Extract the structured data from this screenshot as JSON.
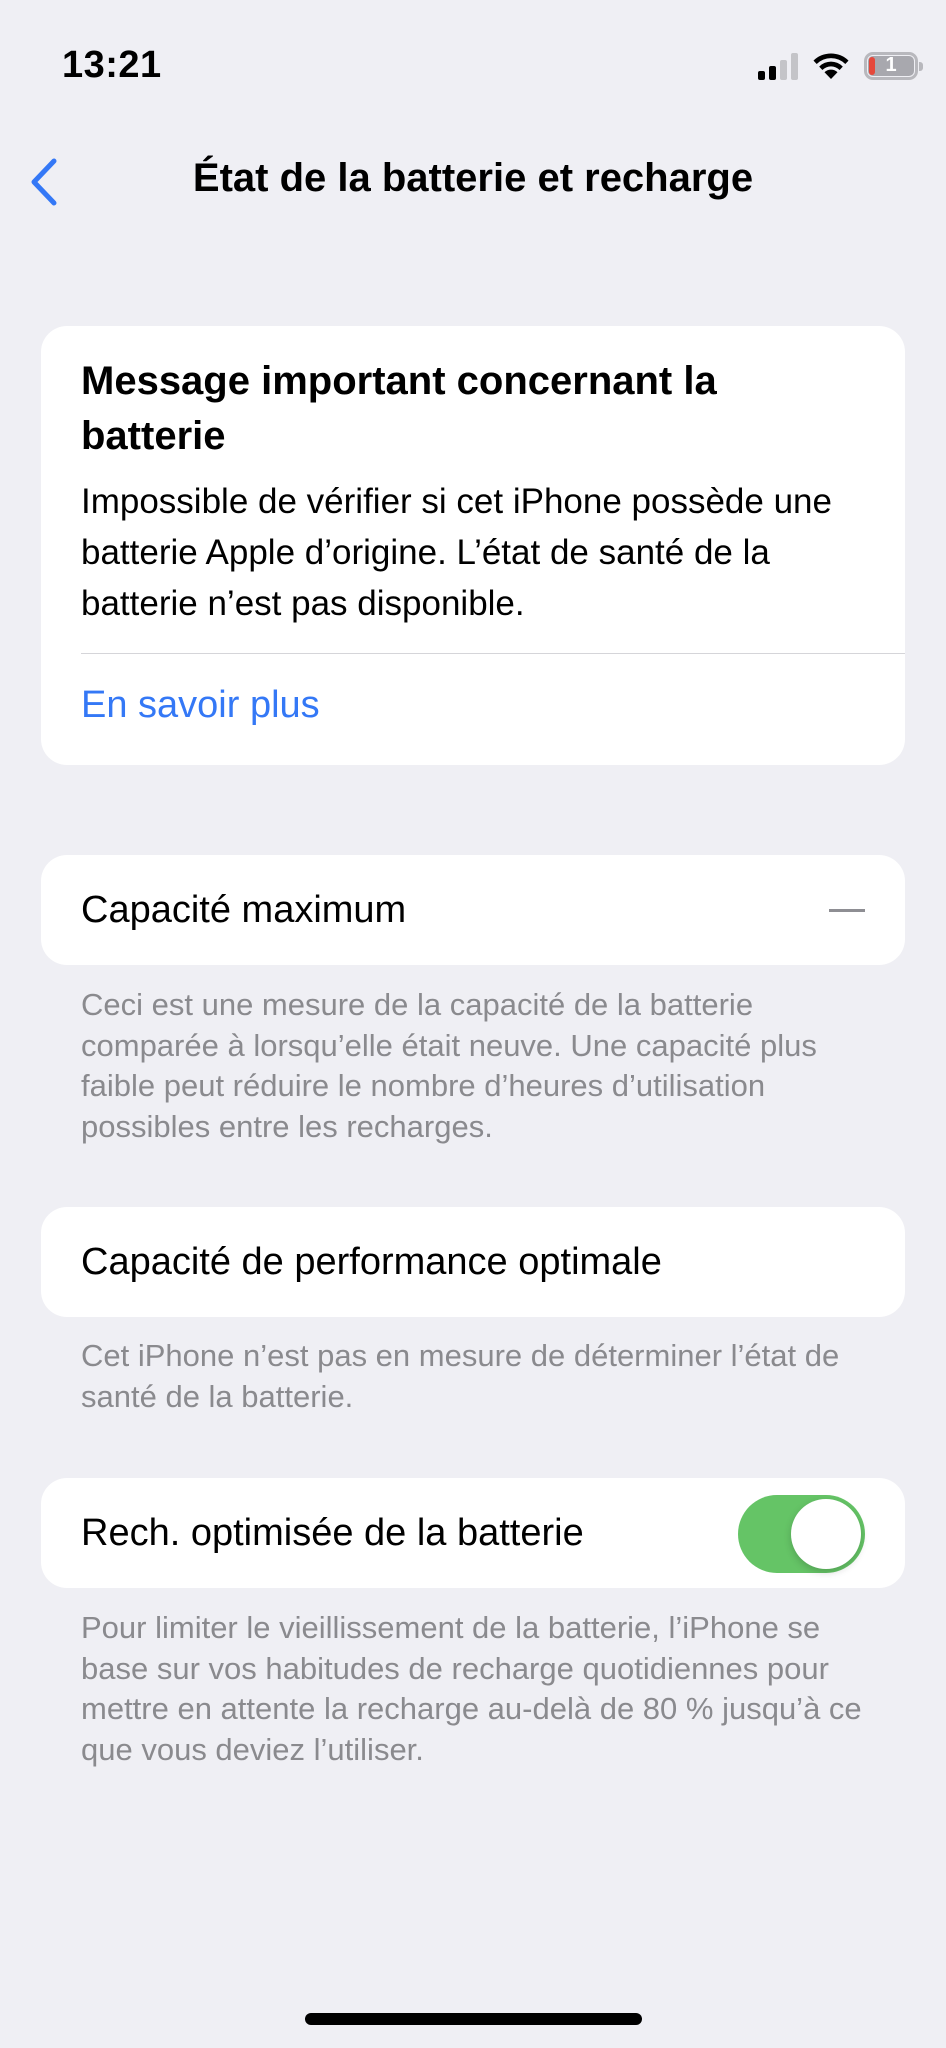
{
  "status_bar": {
    "time": "13:21",
    "battery_level": "1",
    "icons": [
      "cellular-signal-icon",
      "wifi-icon",
      "battery-icon"
    ]
  },
  "nav": {
    "back_icon": "chevron-left-icon",
    "title": "État de la batterie et recharge"
  },
  "alert": {
    "title": "Message important concernant la batterie",
    "body": "Impossible de vérifier si cet iPhone possède une batterie Apple d’origine. L’état de santé de la batterie n’est pas disponible.",
    "link": "En savoir plus"
  },
  "max_capacity": {
    "label": "Capacité maximum",
    "value": "—",
    "footnote": "Ceci est une mesure de la capacité de la batterie comparée à lorsqu’elle était neuve. Une capacité plus faible peut réduire le nombre d’heures d’utilisation possibles entre les recharges."
  },
  "peak_performance": {
    "label": "Capacité de performance optimale",
    "footnote": "Cet iPhone n’est pas en mesure de déterminer l’état de santé de la batterie."
  },
  "optimized_charging": {
    "label": "Rech. optimisée de la batterie",
    "enabled": true,
    "footnote": "Pour limiter le vieillissement de la batterie, l’iPhone se base sur vos habitudes de recharge quotidiennes pour mettre en attente la recharge au-delà de 80 % jusqu’à ce que vous deviez l’utiliser."
  },
  "colors": {
    "background": "#efeff4",
    "accent": "#3478f6",
    "toggle_on": "#65c466",
    "secondary_text": "#8a8a8e",
    "battery_low": "#e5483b"
  }
}
